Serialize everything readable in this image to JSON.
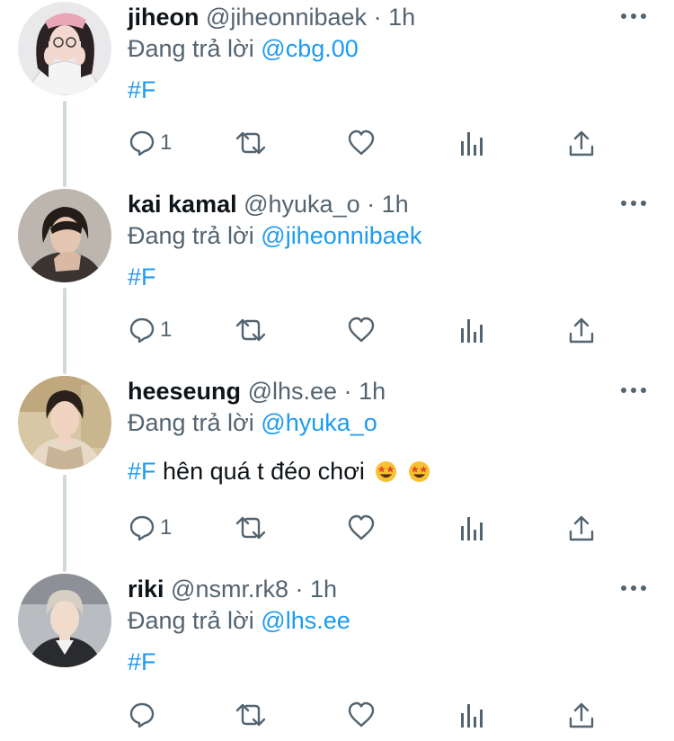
{
  "tweets": [
    {
      "name": "jiheon",
      "handle": "@jiheonnibaek",
      "dot": "·",
      "time": "1h",
      "reply_prefix": "Đang trả lời",
      "reply_to": "@cbg.00",
      "hashtag": "#F",
      "text": "",
      "reply_count": "1"
    },
    {
      "name": "kai kamal",
      "handle": "@hyuka_o",
      "dot": "·",
      "time": "1h",
      "reply_prefix": "Đang trả lời",
      "reply_to": "@jiheonnibaek",
      "hashtag": "#F",
      "text": "",
      "reply_count": "1"
    },
    {
      "name": "heeseung",
      "handle": "@lhs.ee",
      "dot": "·",
      "time": "1h",
      "reply_prefix": "Đang trả lời",
      "reply_to": "@hyuka_o",
      "hashtag": "#F",
      "text": "hên quá t đéo chơi",
      "emoji": [
        "star-struck",
        "star-struck"
      ],
      "reply_count": "1"
    },
    {
      "name": "riki",
      "handle": "@nsmr.rk8",
      "dot": "·",
      "time": "1h",
      "reply_prefix": "Đang trả lời",
      "reply_to": "@lhs.ee",
      "hashtag": "#F",
      "text": "",
      "reply_count": ""
    }
  ],
  "icons": {
    "reply": "speech-bubble-icon",
    "retweet": "retweet-icon",
    "like": "heart-icon",
    "analytics": "bar-chart-icon",
    "share": "share-upload-icon",
    "more": "more-dots-icon"
  },
  "colors": {
    "link": "#1d9bf0",
    "secondary_text": "#536471",
    "primary_text": "#0f1419",
    "thread_line": "#cfd9de"
  }
}
